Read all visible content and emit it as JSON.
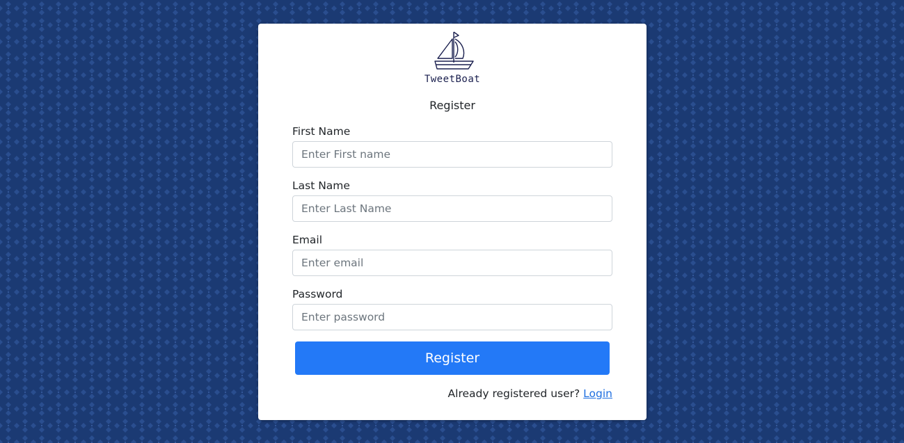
{
  "brand": {
    "name": "TweetBoat",
    "logo_icon": "sailboat-icon"
  },
  "form": {
    "title": "Register",
    "fields": [
      {
        "label": "First Name",
        "placeholder": "Enter First name",
        "value": ""
      },
      {
        "label": "Last Name",
        "placeholder": "Enter Last Name",
        "value": ""
      },
      {
        "label": "Email",
        "placeholder": "Enter email",
        "value": ""
      },
      {
        "label": "Password",
        "placeholder": "Enter password",
        "value": ""
      }
    ],
    "submit_label": "Register"
  },
  "footer": {
    "prompt": "Already registered user?",
    "login_label": "Login"
  },
  "colors": {
    "background": "#1b3a73",
    "pattern": "#2a4e8f",
    "primary": "#2379f7",
    "link": "#1f6fe0"
  }
}
